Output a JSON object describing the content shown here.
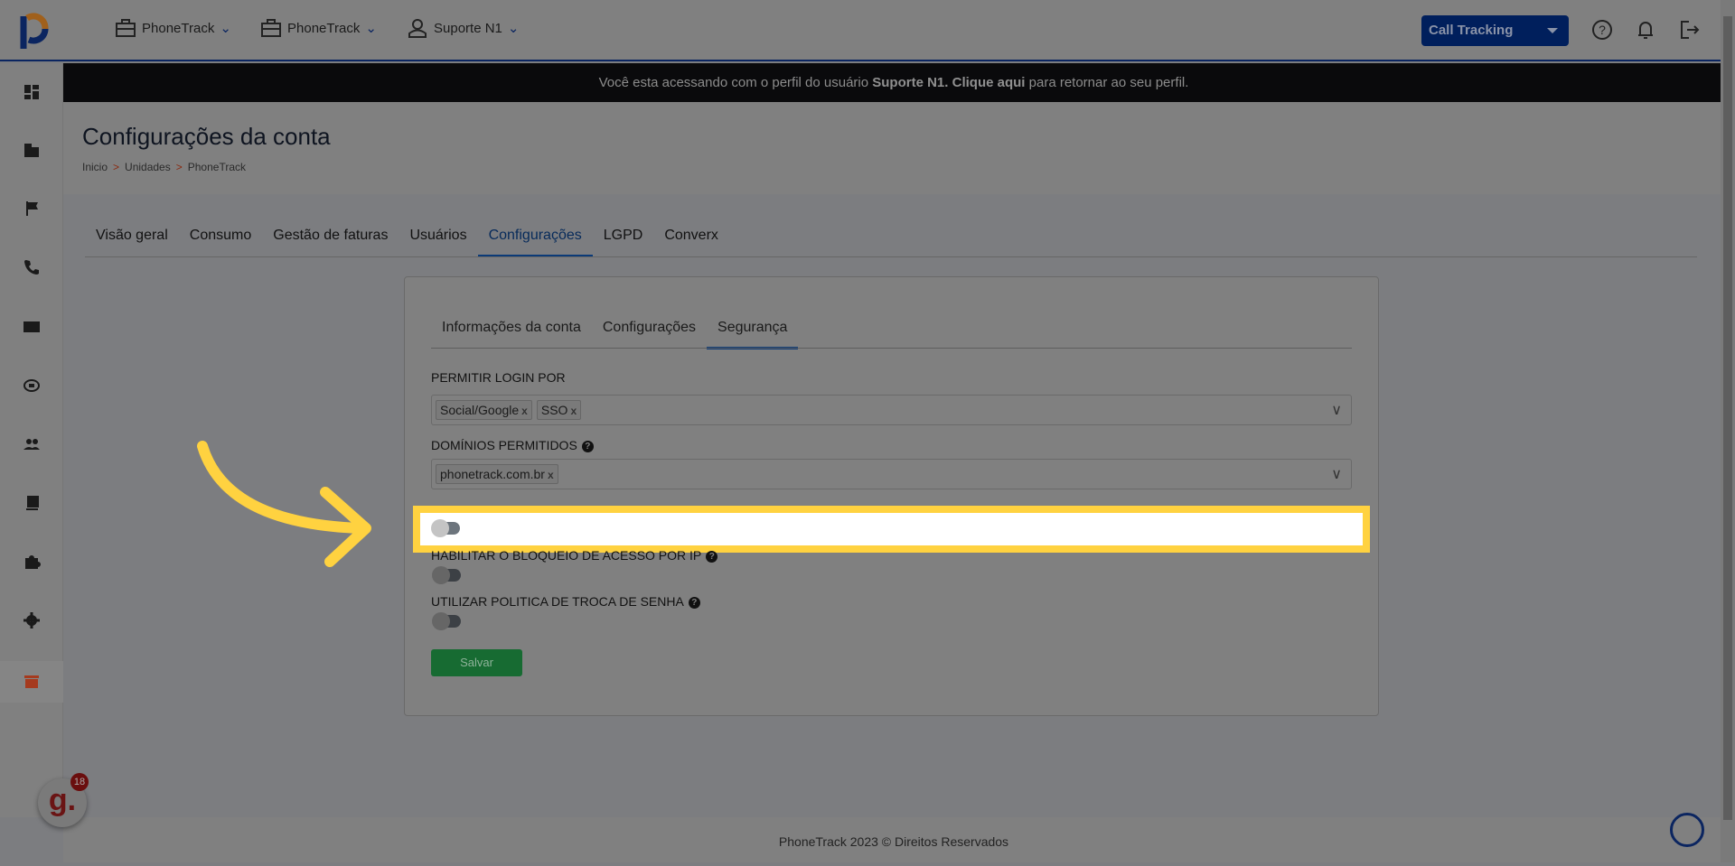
{
  "topbar": {
    "dropdowns": [
      {
        "label": "PhoneTrack",
        "icon": "briefcase-icon"
      },
      {
        "label": "PhoneTrack",
        "icon": "briefcase-icon"
      },
      {
        "label": "Suporte N1",
        "icon": "user-icon"
      }
    ],
    "product_select": "Call Tracking"
  },
  "banner": {
    "pre": "Você esta acessando com o perfil do usuário ",
    "user": "Suporte N1.",
    "link": " Clique aqui",
    "post": " para retornar ao seu perfil."
  },
  "page": {
    "title": "Configurações da conta",
    "breadcrumb": [
      "Inicio",
      "Unidades",
      "PhoneTrack"
    ],
    "breadcrumb_sep": ">"
  },
  "tabs": [
    "Visão geral",
    "Consumo",
    "Gestão de faturas",
    "Usuários",
    "Configurações",
    "LGPD",
    "Converx"
  ],
  "card": {
    "tabs": [
      "Informações da conta",
      "Configurações",
      "Segurança"
    ],
    "login_label": "PERMITIR LOGIN POR",
    "login_chips": [
      "Social/Google",
      "SSO"
    ],
    "domains_label": "DOMÍNIOS PERMITIDOS",
    "domain_chips": [
      "phonetrack.com.br"
    ],
    "ip_label": "HABILITAR O BLOQUEIO DE ACESSO POR IP",
    "pwd_label": "UTILIZAR POLITICA DE TROCA DE SENHA",
    "toggles": {
      "hidden_option": false,
      "ip_block": false,
      "password_policy": false
    },
    "save": "Salvar"
  },
  "badge_count": "18",
  "gupy_letter": "g.",
  "help_glyph": "?",
  "chip_remove": "x",
  "chevron": "∨",
  "footer": "PhoneTrack 2023 © Direitos Reservados",
  "colors": {
    "highlight": "#ffd240",
    "accent": "#001f5c",
    "save": "#176b32"
  }
}
